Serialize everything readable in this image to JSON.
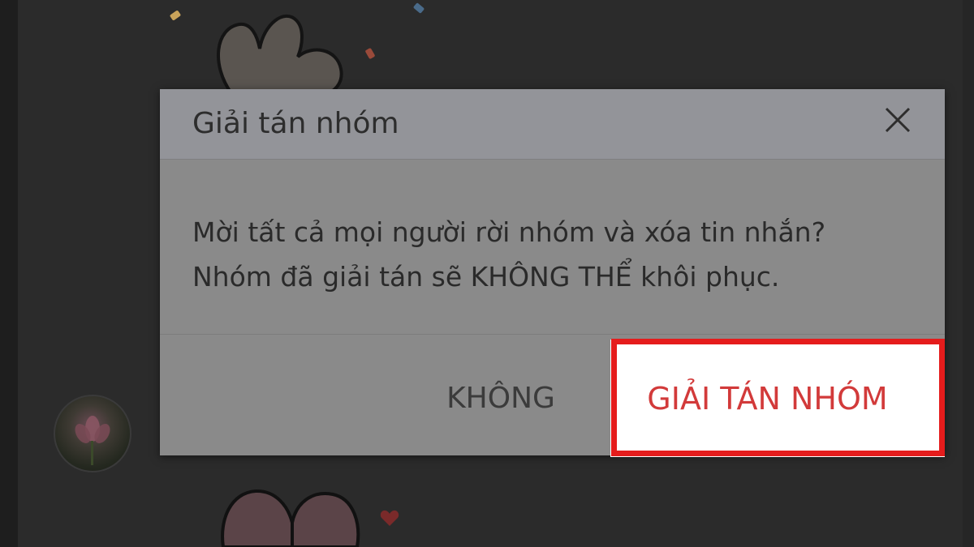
{
  "dialog": {
    "title": "Giải tán nhóm",
    "message_line1": "Mời tất cả mọi người rời nhóm và xóa tin nhắn?",
    "message_line2": "Nhóm đã giải tán sẽ KHÔNG THỂ khôi phục.",
    "cancel_label": "KHÔNG",
    "confirm_label": "GIẢI TÁN NHÓM"
  },
  "icons": {
    "close": "close-icon",
    "avatar": "lotus-avatar",
    "heart": "heart-icon"
  },
  "colors": {
    "confirm_text": "#d23a3a",
    "highlight_border": "#e51c1c",
    "overlay_dim": "#2b2b2b"
  }
}
